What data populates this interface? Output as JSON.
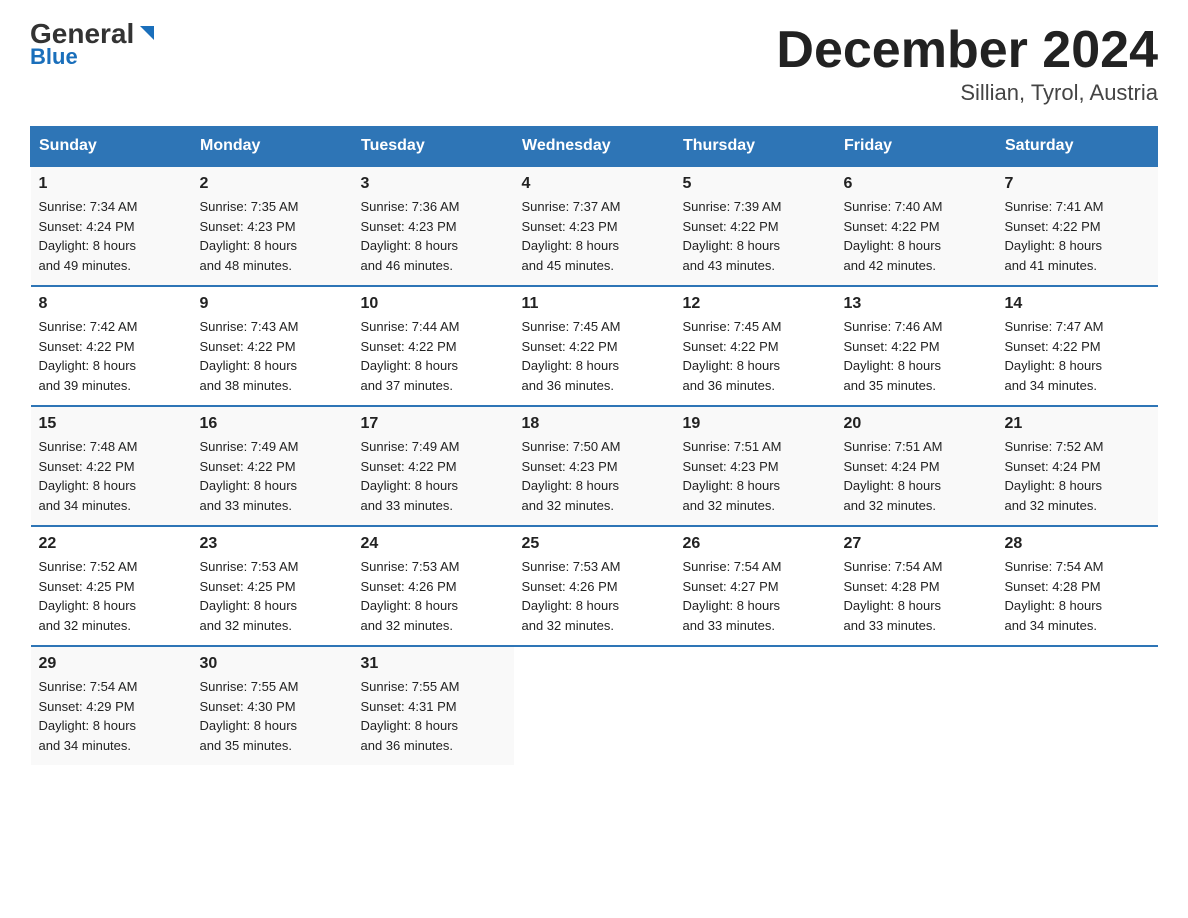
{
  "logo": {
    "general": "General",
    "triangle": "▶",
    "blue": "Blue"
  },
  "title": "December 2024",
  "subtitle": "Sillian, Tyrol, Austria",
  "weekdays": [
    "Sunday",
    "Monday",
    "Tuesday",
    "Wednesday",
    "Thursday",
    "Friday",
    "Saturday"
  ],
  "weeks": [
    [
      {
        "day": "1",
        "sunrise": "7:34 AM",
        "sunset": "4:24 PM",
        "daylight": "8 hours and 49 minutes."
      },
      {
        "day": "2",
        "sunrise": "7:35 AM",
        "sunset": "4:23 PM",
        "daylight": "8 hours and 48 minutes."
      },
      {
        "day": "3",
        "sunrise": "7:36 AM",
        "sunset": "4:23 PM",
        "daylight": "8 hours and 46 minutes."
      },
      {
        "day": "4",
        "sunrise": "7:37 AM",
        "sunset": "4:23 PM",
        "daylight": "8 hours and 45 minutes."
      },
      {
        "day": "5",
        "sunrise": "7:39 AM",
        "sunset": "4:22 PM",
        "daylight": "8 hours and 43 minutes."
      },
      {
        "day": "6",
        "sunrise": "7:40 AM",
        "sunset": "4:22 PM",
        "daylight": "8 hours and 42 minutes."
      },
      {
        "day": "7",
        "sunrise": "7:41 AM",
        "sunset": "4:22 PM",
        "daylight": "8 hours and 41 minutes."
      }
    ],
    [
      {
        "day": "8",
        "sunrise": "7:42 AM",
        "sunset": "4:22 PM",
        "daylight": "8 hours and 39 minutes."
      },
      {
        "day": "9",
        "sunrise": "7:43 AM",
        "sunset": "4:22 PM",
        "daylight": "8 hours and 38 minutes."
      },
      {
        "day": "10",
        "sunrise": "7:44 AM",
        "sunset": "4:22 PM",
        "daylight": "8 hours and 37 minutes."
      },
      {
        "day": "11",
        "sunrise": "7:45 AM",
        "sunset": "4:22 PM",
        "daylight": "8 hours and 36 minutes."
      },
      {
        "day": "12",
        "sunrise": "7:45 AM",
        "sunset": "4:22 PM",
        "daylight": "8 hours and 36 minutes."
      },
      {
        "day": "13",
        "sunrise": "7:46 AM",
        "sunset": "4:22 PM",
        "daylight": "8 hours and 35 minutes."
      },
      {
        "day": "14",
        "sunrise": "7:47 AM",
        "sunset": "4:22 PM",
        "daylight": "8 hours and 34 minutes."
      }
    ],
    [
      {
        "day": "15",
        "sunrise": "7:48 AM",
        "sunset": "4:22 PM",
        "daylight": "8 hours and 34 minutes."
      },
      {
        "day": "16",
        "sunrise": "7:49 AM",
        "sunset": "4:22 PM",
        "daylight": "8 hours and 33 minutes."
      },
      {
        "day": "17",
        "sunrise": "7:49 AM",
        "sunset": "4:22 PM",
        "daylight": "8 hours and 33 minutes."
      },
      {
        "day": "18",
        "sunrise": "7:50 AM",
        "sunset": "4:23 PM",
        "daylight": "8 hours and 32 minutes."
      },
      {
        "day": "19",
        "sunrise": "7:51 AM",
        "sunset": "4:23 PM",
        "daylight": "8 hours and 32 minutes."
      },
      {
        "day": "20",
        "sunrise": "7:51 AM",
        "sunset": "4:24 PM",
        "daylight": "8 hours and 32 minutes."
      },
      {
        "day": "21",
        "sunrise": "7:52 AM",
        "sunset": "4:24 PM",
        "daylight": "8 hours and 32 minutes."
      }
    ],
    [
      {
        "day": "22",
        "sunrise": "7:52 AM",
        "sunset": "4:25 PM",
        "daylight": "8 hours and 32 minutes."
      },
      {
        "day": "23",
        "sunrise": "7:53 AM",
        "sunset": "4:25 PM",
        "daylight": "8 hours and 32 minutes."
      },
      {
        "day": "24",
        "sunrise": "7:53 AM",
        "sunset": "4:26 PM",
        "daylight": "8 hours and 32 minutes."
      },
      {
        "day": "25",
        "sunrise": "7:53 AM",
        "sunset": "4:26 PM",
        "daylight": "8 hours and 32 minutes."
      },
      {
        "day": "26",
        "sunrise": "7:54 AM",
        "sunset": "4:27 PM",
        "daylight": "8 hours and 33 minutes."
      },
      {
        "day": "27",
        "sunrise": "7:54 AM",
        "sunset": "4:28 PM",
        "daylight": "8 hours and 33 minutes."
      },
      {
        "day": "28",
        "sunrise": "7:54 AM",
        "sunset": "4:28 PM",
        "daylight": "8 hours and 34 minutes."
      }
    ],
    [
      {
        "day": "29",
        "sunrise": "7:54 AM",
        "sunset": "4:29 PM",
        "daylight": "8 hours and 34 minutes."
      },
      {
        "day": "30",
        "sunrise": "7:55 AM",
        "sunset": "4:30 PM",
        "daylight": "8 hours and 35 minutes."
      },
      {
        "day": "31",
        "sunrise": "7:55 AM",
        "sunset": "4:31 PM",
        "daylight": "8 hours and 36 minutes."
      },
      null,
      null,
      null,
      null
    ]
  ],
  "labels": {
    "sunrise": "Sunrise:",
    "sunset": "Sunset:",
    "daylight": "Daylight:"
  }
}
